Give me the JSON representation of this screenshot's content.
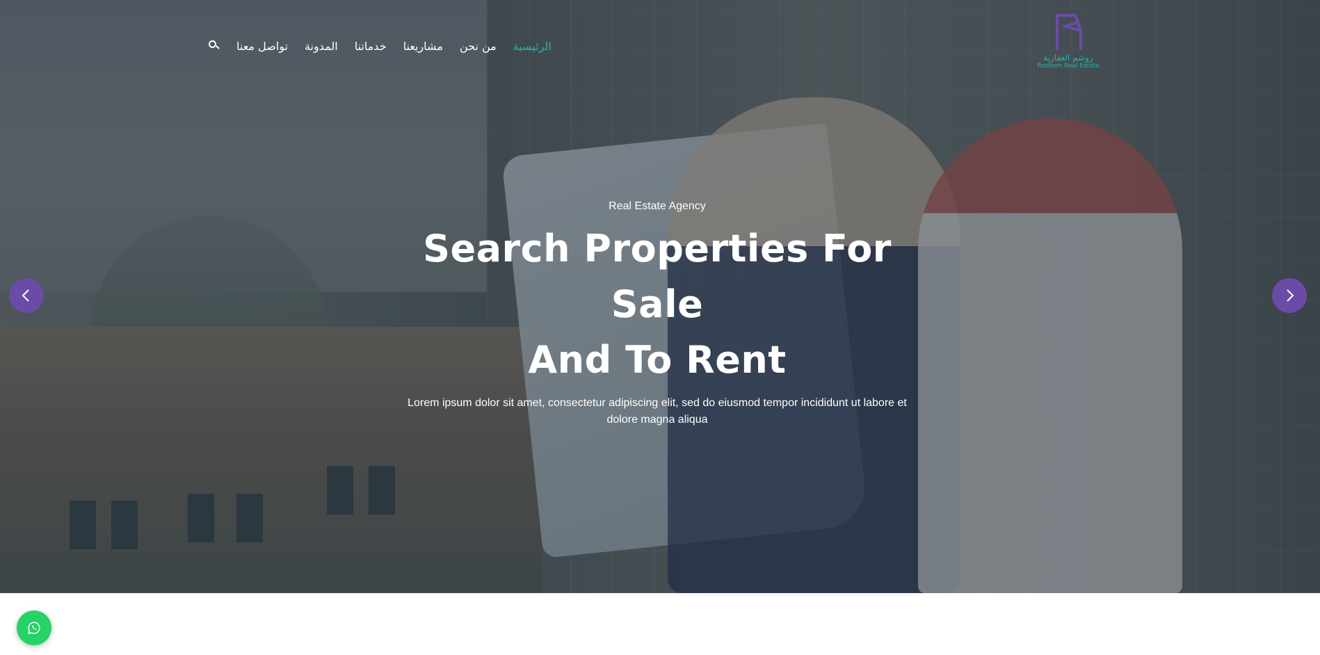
{
  "nav": {
    "items": [
      {
        "label": "الرئيسية",
        "active": true
      },
      {
        "label": "من نحن",
        "active": false
      },
      {
        "label": "مشاريعنا",
        "active": false
      },
      {
        "label": "خدماتنا",
        "active": false
      },
      {
        "label": "المدونة",
        "active": false
      },
      {
        "label": "تواصل معنا",
        "active": false
      }
    ],
    "search_icon": "search-icon"
  },
  "logo": {
    "arabic_name": "روشم العقارية",
    "english_name": "Roshem Real Estate",
    "mark_color": "#6a4ba8",
    "text_color": "#27b3a7"
  },
  "hero": {
    "eyebrow": "Real Estate Agency",
    "title_line1": "Search Properties For Sale",
    "title_line2": "And To Rent",
    "description": "Lorem ipsum dolor sit amet, consectetur adipiscing elit, sed do eiusmod tempor incididunt ut labore et dolore magna aliqua"
  },
  "slider": {
    "prev_icon": "chevron-left-icon",
    "next_icon": "chevron-right-icon",
    "arrow_color": "#6a4ba8"
  },
  "floating": {
    "whatsapp_icon": "whatsapp-icon",
    "whatsapp_color": "#25d366"
  },
  "colors": {
    "accent": "#2bb3a7",
    "brand_purple": "#6a4ba8"
  }
}
